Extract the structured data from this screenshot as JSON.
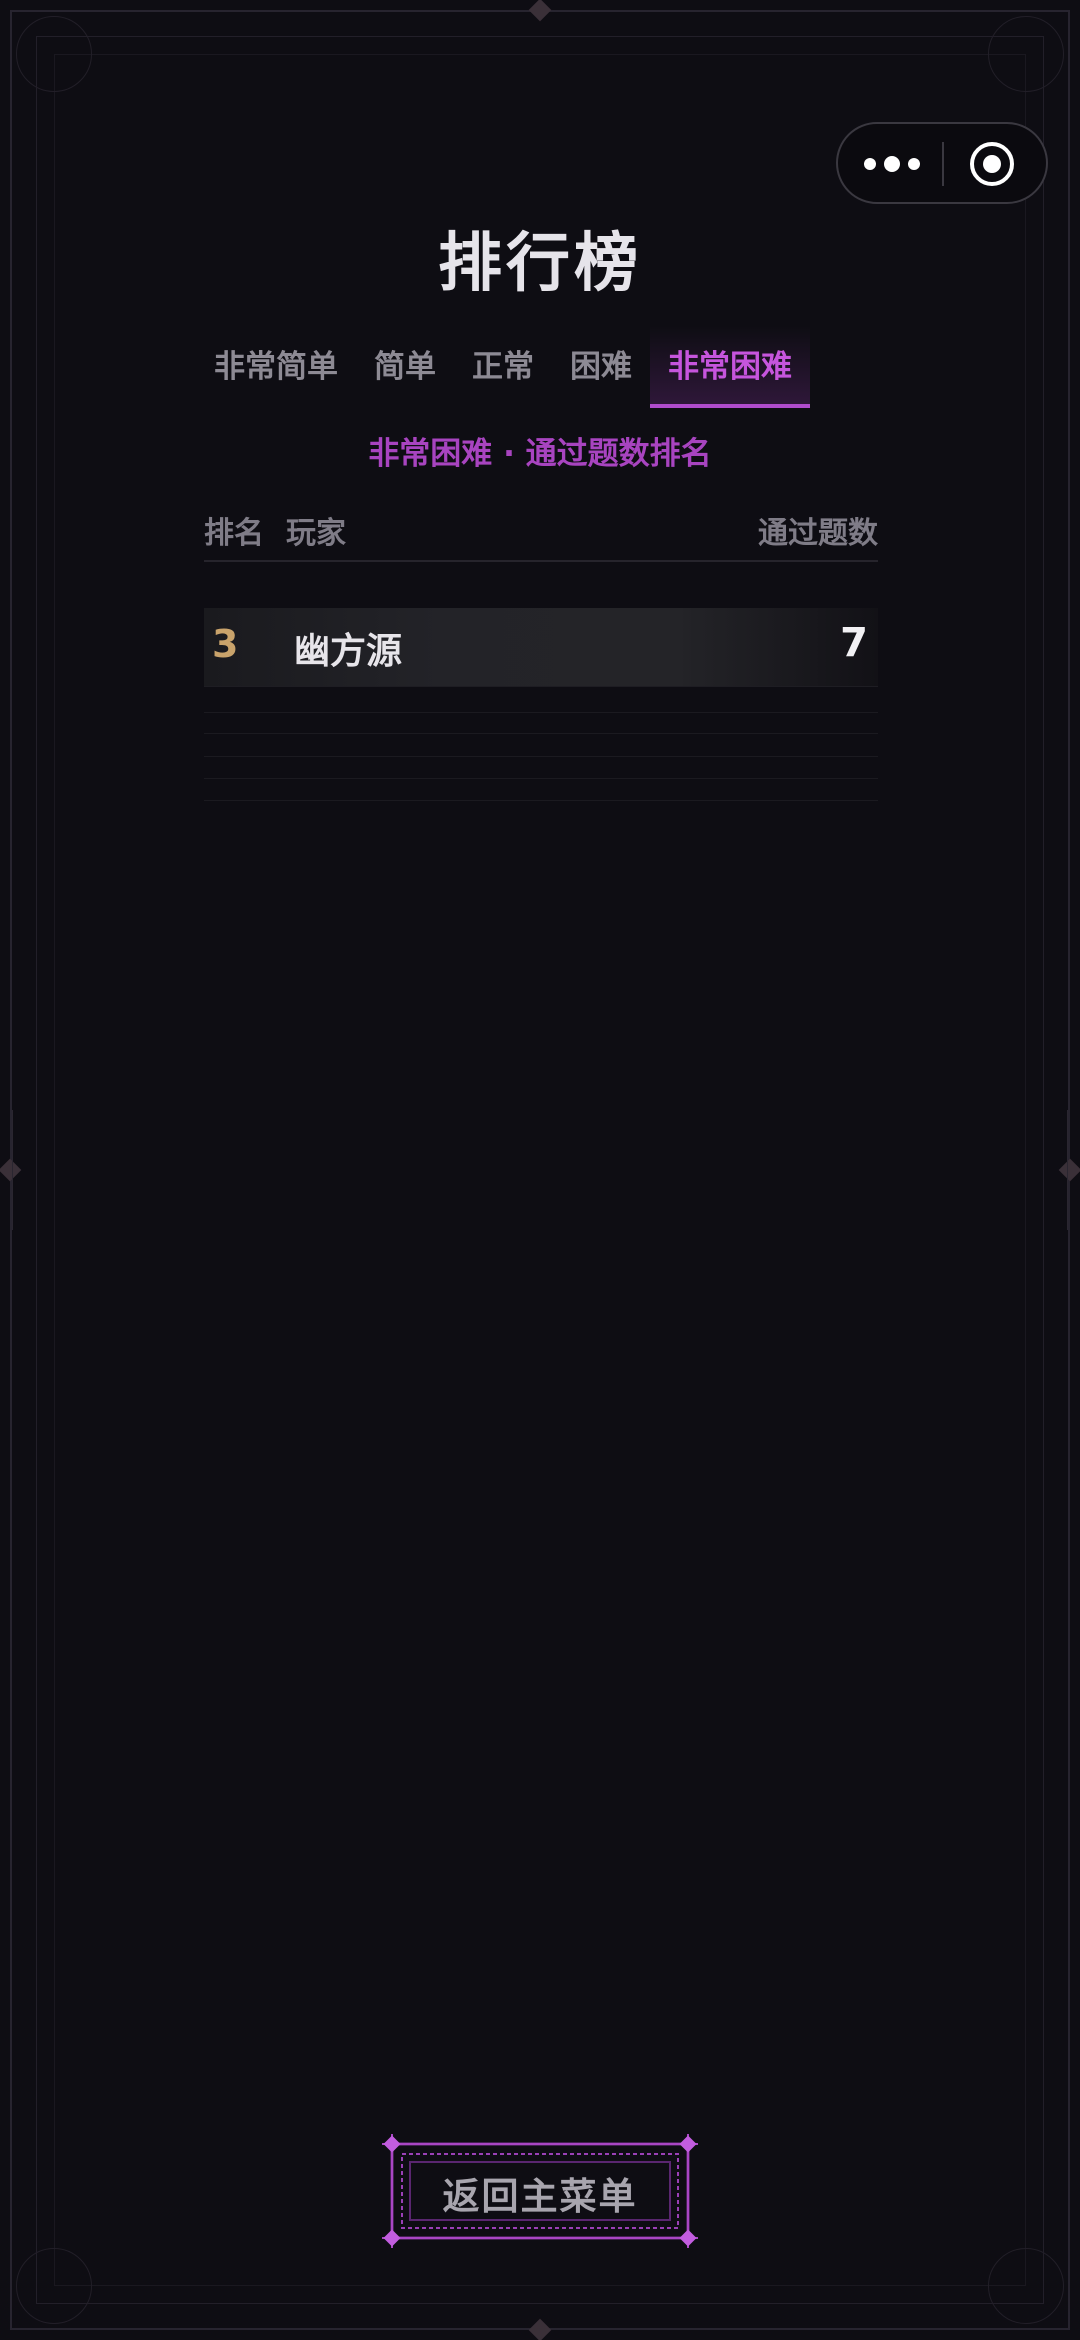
{
  "page": {
    "title": "排行榜"
  },
  "tabs": [
    {
      "label": "非常简单",
      "active": false
    },
    {
      "label": "简单",
      "active": false
    },
    {
      "label": "正常",
      "active": false
    },
    {
      "label": "困难",
      "active": false
    },
    {
      "label": "非常困难",
      "active": true
    }
  ],
  "subtitle": "非常困难 · 通过题数排名",
  "table": {
    "headers": {
      "rank": "排名",
      "player": "玩家",
      "count": "通过题数"
    },
    "rows": [
      {
        "rank": "3",
        "name": "幽方源",
        "count": "7"
      }
    ]
  },
  "back_button": {
    "label": "返回主菜单"
  },
  "capsule": {
    "more_icon": "more-dots-icon",
    "close_icon": "target-close-icon"
  },
  "colors": {
    "background": "#0e0d13",
    "accent": "#b04ccc",
    "rank_gold": "#c9a36b",
    "text_primary": "#e7e5ea",
    "text_muted": "#8d8a94"
  }
}
